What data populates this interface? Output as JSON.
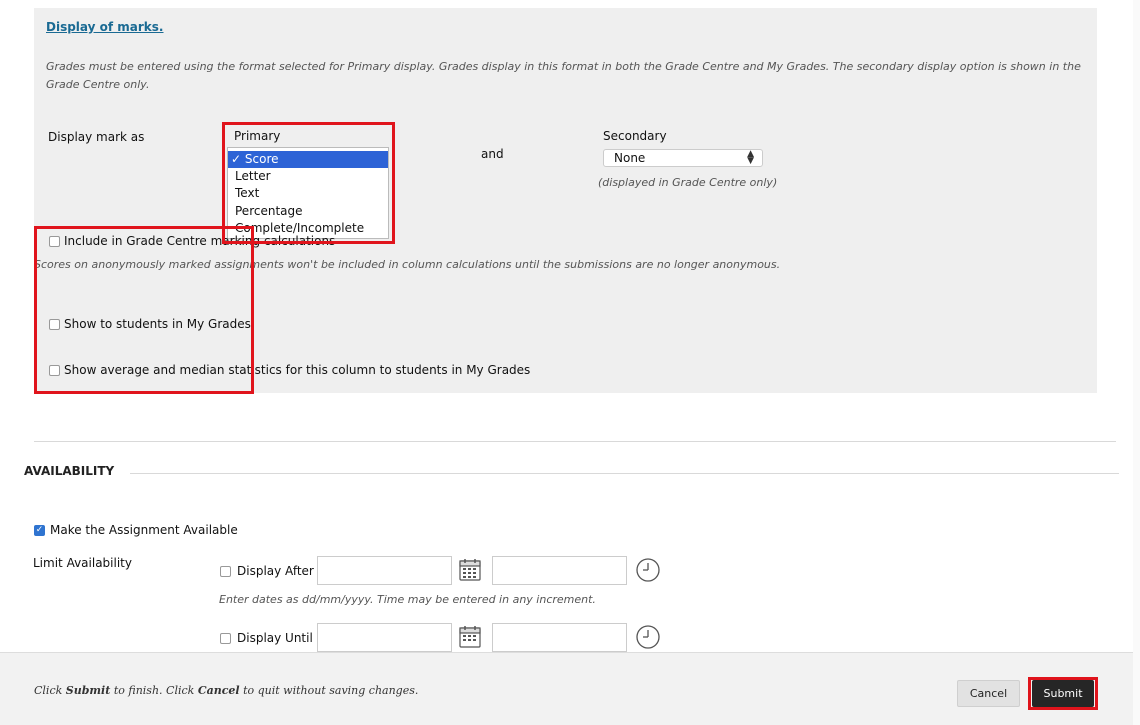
{
  "marks": {
    "link_label": "Display of marks.",
    "description": "Grades must be entered using the format selected for Primary display. Grades display in this format in both the Grade Centre and My Grades. The secondary display option is shown in the Grade Centre only.",
    "display_label": "Display mark as",
    "primary": {
      "header": "Primary",
      "options": [
        "Score",
        "Letter",
        "Text",
        "Percentage",
        "Complete/Incomplete"
      ],
      "selected": "Score",
      "checkmark": "✓"
    },
    "and_label": "and",
    "secondary": {
      "label": "Secondary",
      "value": "None",
      "note": "(displayed in Grade Centre only)"
    },
    "include_calc": {
      "label": "Include in Grade Centre marking calculations",
      "checked": false,
      "note": "Scores on anonymously marked assignments won't be included in column calculations until the submissions are no longer anonymous."
    },
    "show_students": {
      "label": "Show to students in My Grades",
      "checked": false
    },
    "show_stats": {
      "label": "Show average and median statistics for this column to students in My Grades",
      "checked": false
    }
  },
  "availability": {
    "heading": "AVAILABILITY",
    "make_available": {
      "label": "Make the Assignment Available",
      "checked": true
    },
    "limit_label": "Limit Availability",
    "display_after": {
      "label": "Display After",
      "checked": false,
      "date_value": "",
      "time_value": ""
    },
    "date_note": "Enter dates as dd/mm/yyyy. Time may be entered in any increment.",
    "display_until": {
      "label": "Display Until",
      "checked": false,
      "date_value": "",
      "time_value": ""
    }
  },
  "footer": {
    "text_click": "Click ",
    "text_submit": "Submit",
    "text_mid": " to finish. Click ",
    "text_cancel": "Cancel",
    "text_end": " to quit without saving changes.",
    "cancel_label": "Cancel",
    "submit_label": "Submit"
  },
  "colors": {
    "highlight": "#e0141c",
    "selected_option": "#2d63d6",
    "link": "#1a6a93",
    "submit_bg": "#262626"
  },
  "icons": {
    "calendar": "calendar-icon",
    "clock": "clock-icon",
    "checkmark": "checkmark-icon",
    "select_arrows": "select-arrows-icon"
  }
}
